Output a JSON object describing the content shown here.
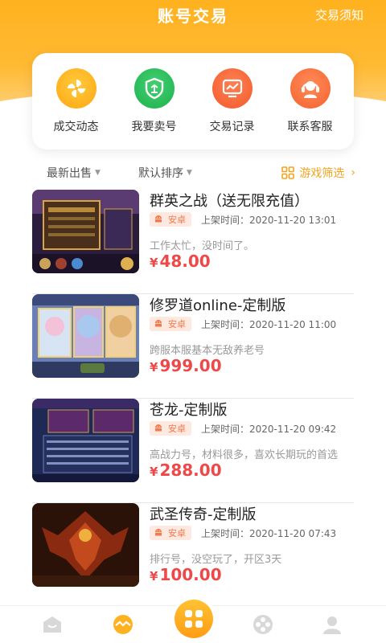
{
  "header": {
    "title": "账号交易",
    "notice": "交易须知"
  },
  "actions": [
    {
      "label": "成交动态",
      "icon": "pinwheel-icon",
      "color": "#ffb21f"
    },
    {
      "label": "我要卖号",
      "icon": "shield-icon",
      "color": "#2fbf5f"
    },
    {
      "label": "交易记录",
      "icon": "chart-monitor-icon",
      "color": "#ff6b3d"
    },
    {
      "label": "联系客服",
      "icon": "headset-icon",
      "color": "#ff7a45"
    }
  ],
  "filters": {
    "latest": "最新出售",
    "sort": "默认排序",
    "game": "游戏筛选"
  },
  "listings": [
    {
      "title": "群英之战（送无限充值）",
      "platform": "安卓",
      "listed": "上架时间：2020-11-20 13:01",
      "desc": "工作太忙，没时间了。",
      "currency": "¥",
      "price": "48.00"
    },
    {
      "title": "修罗道online-定制版",
      "platform": "安卓",
      "listed": "上架时间：2020-11-20 11:00",
      "desc": "跨服本服基本无敌养老号",
      "currency": "¥",
      "price": "999.00"
    },
    {
      "title": "苍龙-定制版",
      "platform": "安卓",
      "listed": "上架时间：2020-11-20 09:42",
      "desc": "高战力号，材料很多，喜欢长期玩的首选",
      "currency": "¥",
      "price": "288.00"
    },
    {
      "title": "武圣传奇-定制版",
      "platform": "安卓",
      "listed": "上架时间：2020-11-20 07:43",
      "desc": "排行号，没空玩了，开区3天",
      "currency": "¥",
      "price": "100.00"
    }
  ],
  "tabbar": {
    "items": [
      "home-icon",
      "trade-icon",
      "apps-icon",
      "film-reel-icon",
      "user-icon"
    ],
    "active": "trade-icon"
  }
}
